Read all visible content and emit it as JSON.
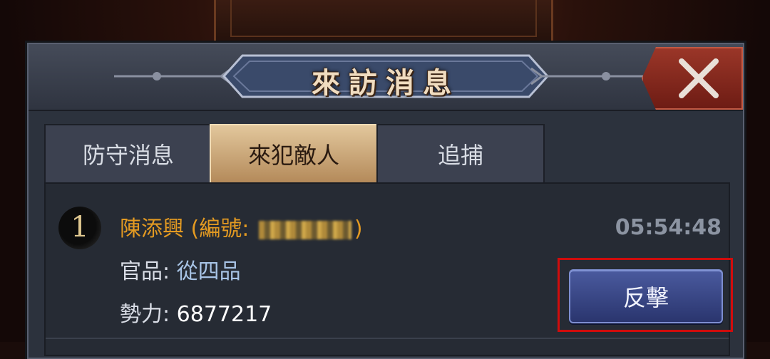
{
  "dialog": {
    "title": "來訪消息",
    "close_icon": "close-x-icon"
  },
  "tabs": [
    {
      "label": "防守消息",
      "active": false
    },
    {
      "label": "來犯敵人",
      "active": true
    },
    {
      "label": "追捕",
      "active": false
    }
  ],
  "entries": [
    {
      "rank": "1",
      "name_prefix": "陳添興 (編號: ",
      "name_suffix": ")",
      "rank_label": "官品: ",
      "rank_value": "從四品",
      "power_label": "勢力: ",
      "power_value": "6877217",
      "time": "05:54:48",
      "action_label": "反擊"
    }
  ],
  "colors": {
    "accent_gold": "#e39a22",
    "highlight_red": "#d00c0c",
    "button_blue": "#3a4888"
  }
}
